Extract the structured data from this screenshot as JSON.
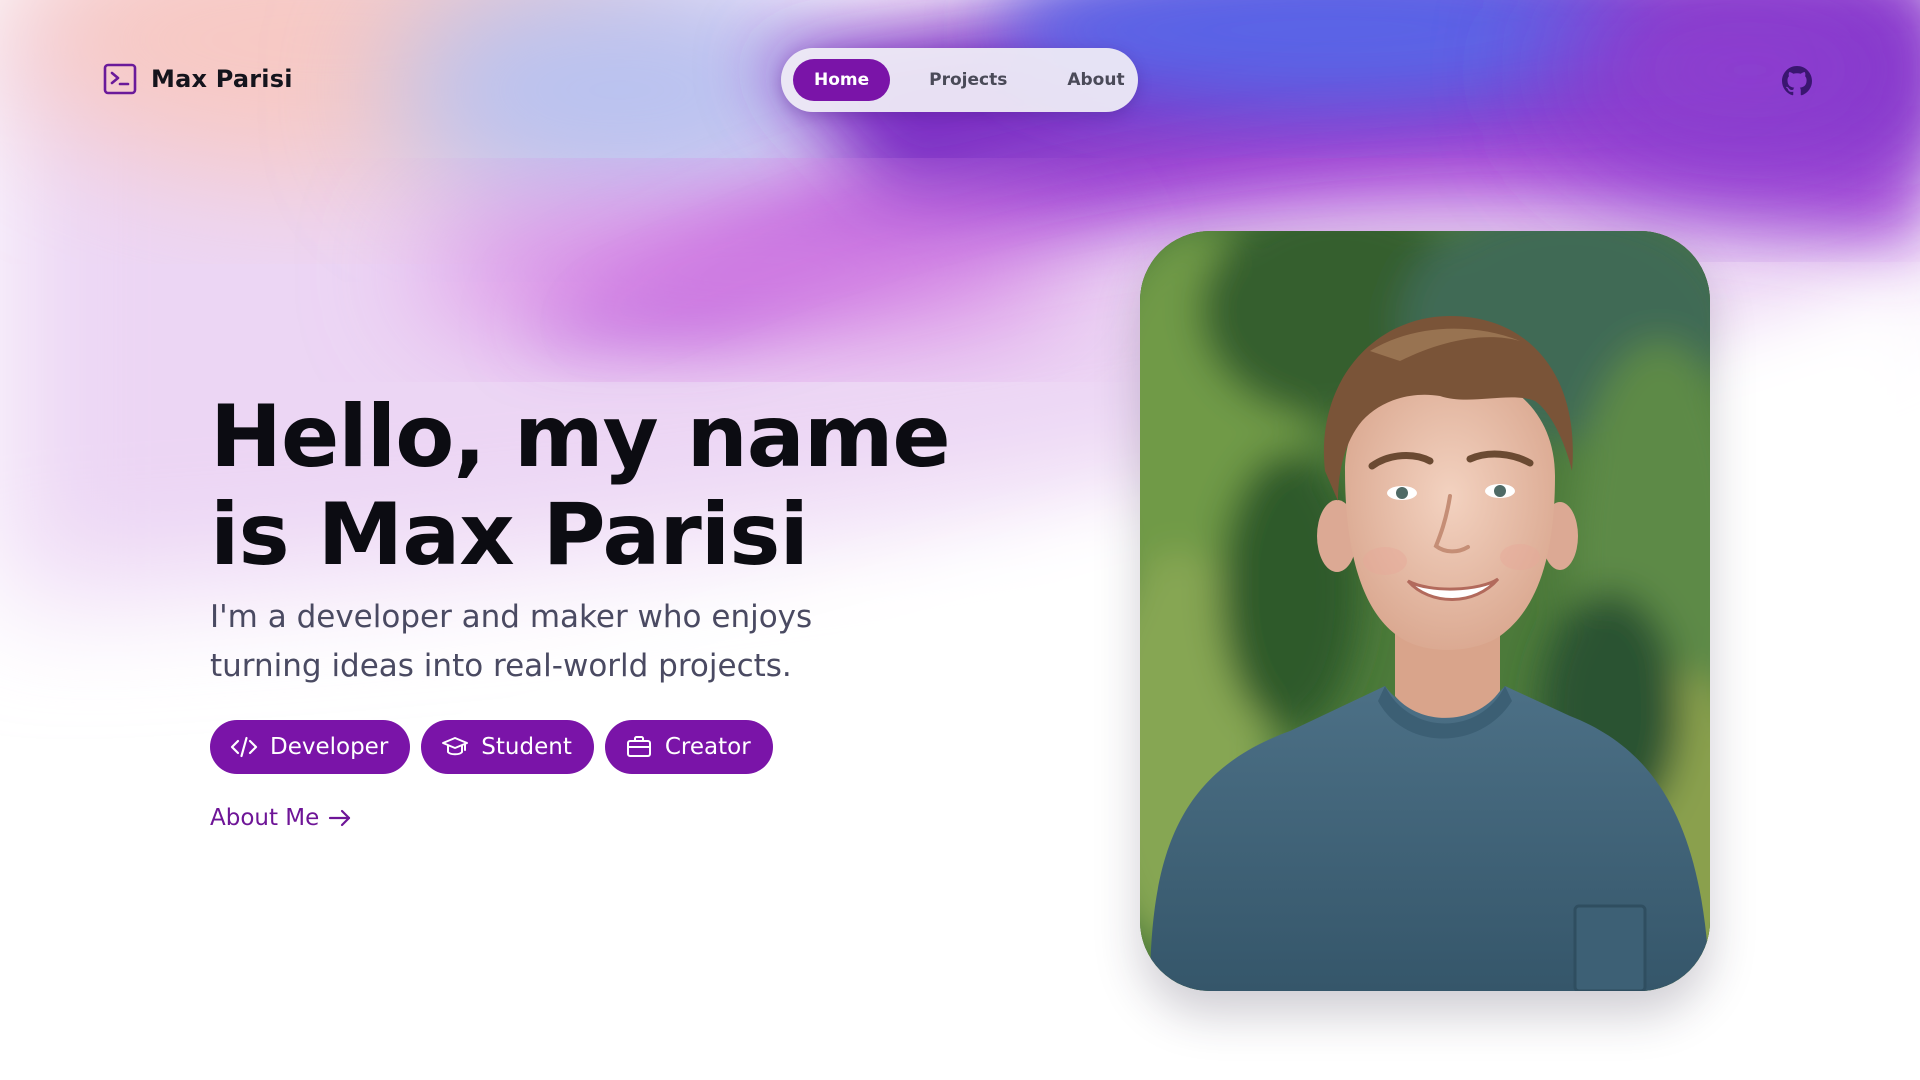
{
  "header": {
    "brand_name": "Max Parisi",
    "brand_icon": "terminal-icon",
    "github_icon": "github-icon"
  },
  "nav": {
    "items": [
      {
        "label": "Home",
        "active": true
      },
      {
        "label": "Projects",
        "active": false
      },
      {
        "label": "About",
        "active": false
      }
    ]
  },
  "hero": {
    "title_line1": "Hello, my name",
    "title_line2": "is Max Parisi",
    "subtitle": "I'm a developer and maker who enjoys turning ideas into real-world projects.",
    "chips": [
      {
        "label": "Developer",
        "icon": "code-icon"
      },
      {
        "label": "Student",
        "icon": "graduation-cap-icon"
      },
      {
        "label": "Creator",
        "icon": "briefcase-icon"
      }
    ],
    "about_link": "About Me",
    "about_link_icon": "arrow-right-icon"
  },
  "portrait": {
    "subject": "profile-photo"
  },
  "colors": {
    "accent": "#7a14a8",
    "accent_text": "#6e1597",
    "heading": "#0c0c12",
    "body_text": "#4a4a62"
  }
}
